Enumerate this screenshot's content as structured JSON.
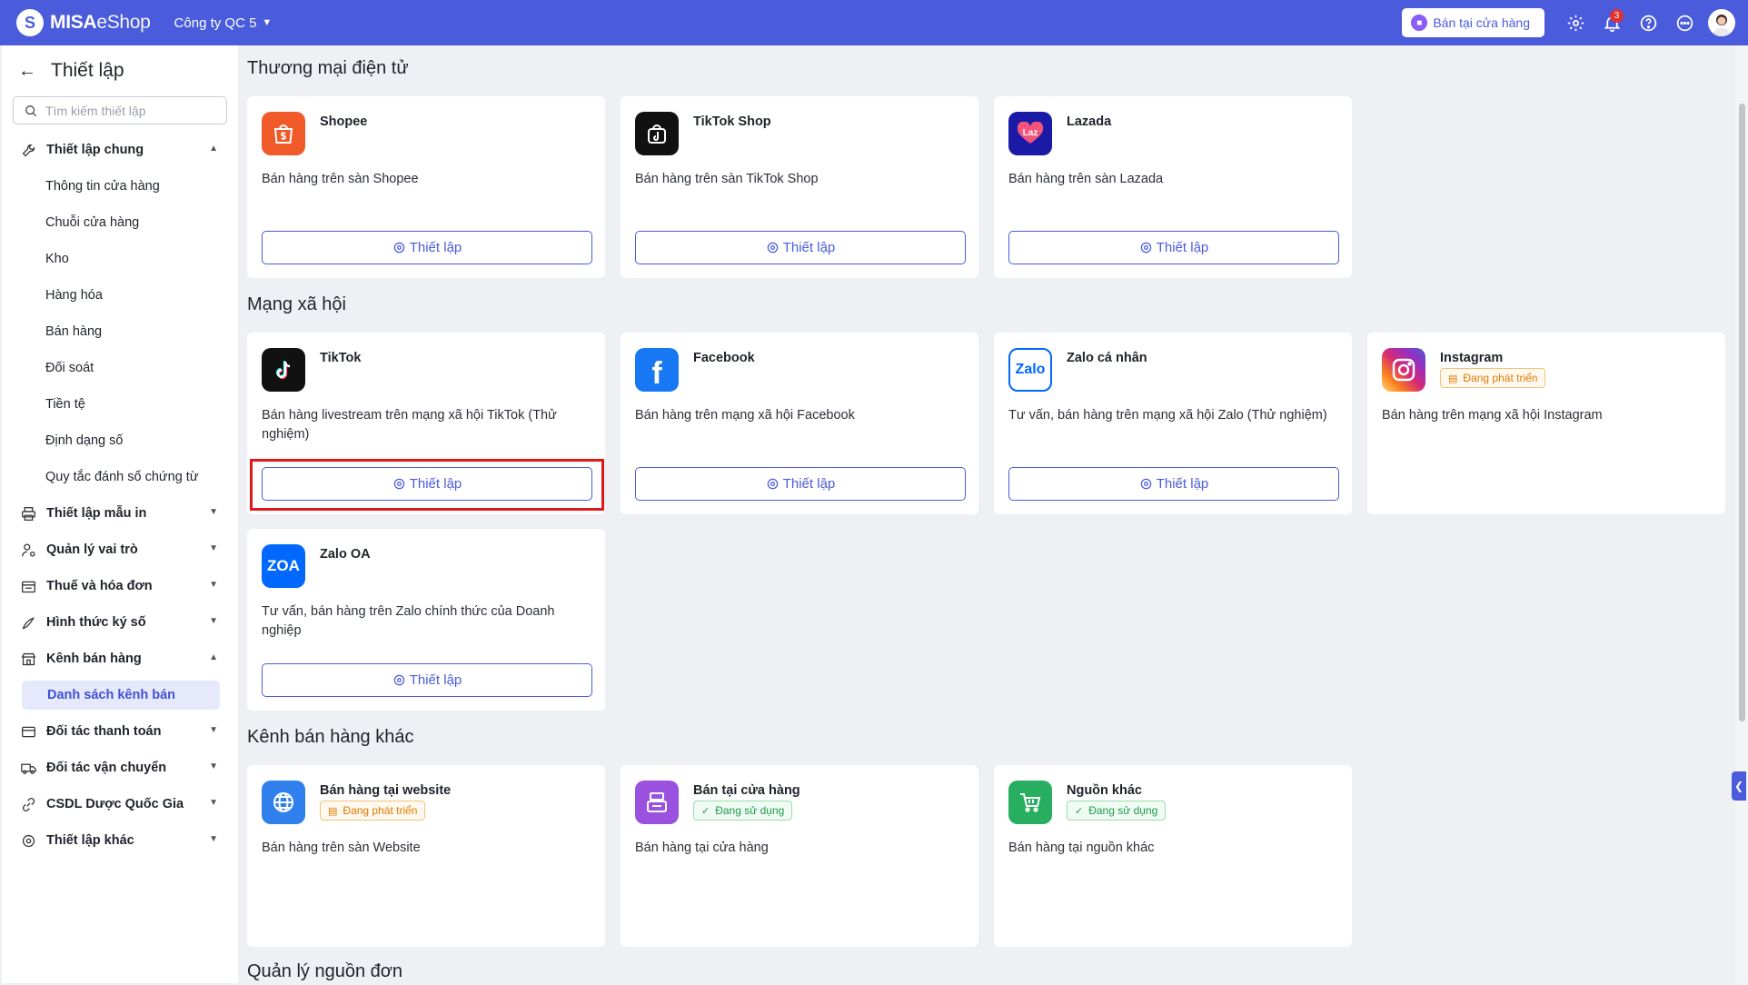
{
  "topbar": {
    "brand_bold": "MISA",
    "brand_light": "eShop",
    "company": "Công ty QC 5",
    "store_button": "Bán tại cửa hàng",
    "notification_count": "3",
    "brand_color": "#4a5bdc"
  },
  "sidebar": {
    "title": "Thiết lập",
    "search_placeholder": "Tìm kiếm thiết lập",
    "groups": [
      {
        "label": "Thiết lập chung",
        "icon": "wrench-icon",
        "expanded": true
      },
      {
        "label": "Thiết lập mẫu in",
        "icon": "printer-icon",
        "expanded": false
      },
      {
        "label": "Quản lý vai trò",
        "icon": "user-settings-icon",
        "expanded": false
      },
      {
        "label": "Thuế và hóa đơn",
        "icon": "invoice-icon",
        "expanded": false
      },
      {
        "label": "Hình thức ký số",
        "icon": "pen-icon",
        "expanded": false
      },
      {
        "label": "Kênh bán hàng",
        "icon": "store-icon",
        "expanded": true
      },
      {
        "label": "Đối tác thanh toán",
        "icon": "card-icon",
        "expanded": false
      },
      {
        "label": "Đối tác vận chuyển",
        "icon": "truck-icon",
        "expanded": false
      },
      {
        "label": "CSDL Dược Quốc Gia",
        "icon": "link-icon",
        "expanded": false
      },
      {
        "label": "Thiết lập khác",
        "icon": "gear-icon",
        "expanded": false
      }
    ],
    "general_items": [
      "Thông tin cửa hàng",
      "Chuỗi cửa hàng",
      "Kho",
      "Hàng hóa",
      "Bán hàng",
      "Đối soát",
      "Tiền tệ",
      "Định dạng số",
      "Quy tắc đánh số chứng từ"
    ],
    "channel_items": [
      "Danh sách kênh bán"
    ]
  },
  "sections": {
    "ecommerce": "Thương mại điện tử",
    "social": "Mạng xã hội",
    "other": "Kênh bán hàng khác",
    "orders": "Quản lý nguồn đơn"
  },
  "setup_label": "Thiết lập",
  "cards": {
    "shopee": {
      "name": "Shopee",
      "desc": "Bán hàng trên sàn Shopee",
      "color": "#f05a28"
    },
    "tiktokshop": {
      "name": "TikTok Shop",
      "desc": "Bán hàng trên sàn TikTok Shop",
      "color": "#111111"
    },
    "lazada": {
      "name": "Lazada",
      "desc": "Bán hàng trên sàn Lazada",
      "color": "#1a1aa6"
    },
    "tiktok": {
      "name": "TikTok",
      "desc": "Bán hàng livestream trên mạng xã hội TikTok (Thử nghiệm)",
      "color": "#111111"
    },
    "facebook": {
      "name": "Facebook",
      "desc": "Bán hàng trên mạng xã hội Facebook",
      "color": "#1877f2"
    },
    "zalo": {
      "name": "Zalo cá nhân",
      "desc": "Tư vấn, bán hàng trên mạng xã hội Zalo (Thử nghiệm)",
      "color": "#0068ff"
    },
    "instagram": {
      "name": "Instagram",
      "tag": "Đang phát triển",
      "desc": "Bán hàng trên mạng xã hội Instagram",
      "color": "#d62976"
    },
    "zaloa": {
      "name": "Zalo OA",
      "logo_text": "ZOA",
      "desc": "Tư vấn, bán hàng trên Zalo chính thức của Doanh nghiệp",
      "color": "#0068ff"
    },
    "website": {
      "name": "Bán hàng tại website",
      "tag": "Đang phát triển",
      "desc": "Bán hàng trên sàn Website",
      "color": "#2f80ed"
    },
    "store": {
      "name": "Bán tại cửa hàng",
      "tag": "Đang sử dụng",
      "desc": "Bán hàng tại cửa hàng",
      "color": "#9b51e0"
    },
    "other": {
      "name": "Nguồn khác",
      "tag": "Đang sử dụng",
      "desc": "Bán hàng tại nguồn khác",
      "color": "#27ae60"
    }
  }
}
